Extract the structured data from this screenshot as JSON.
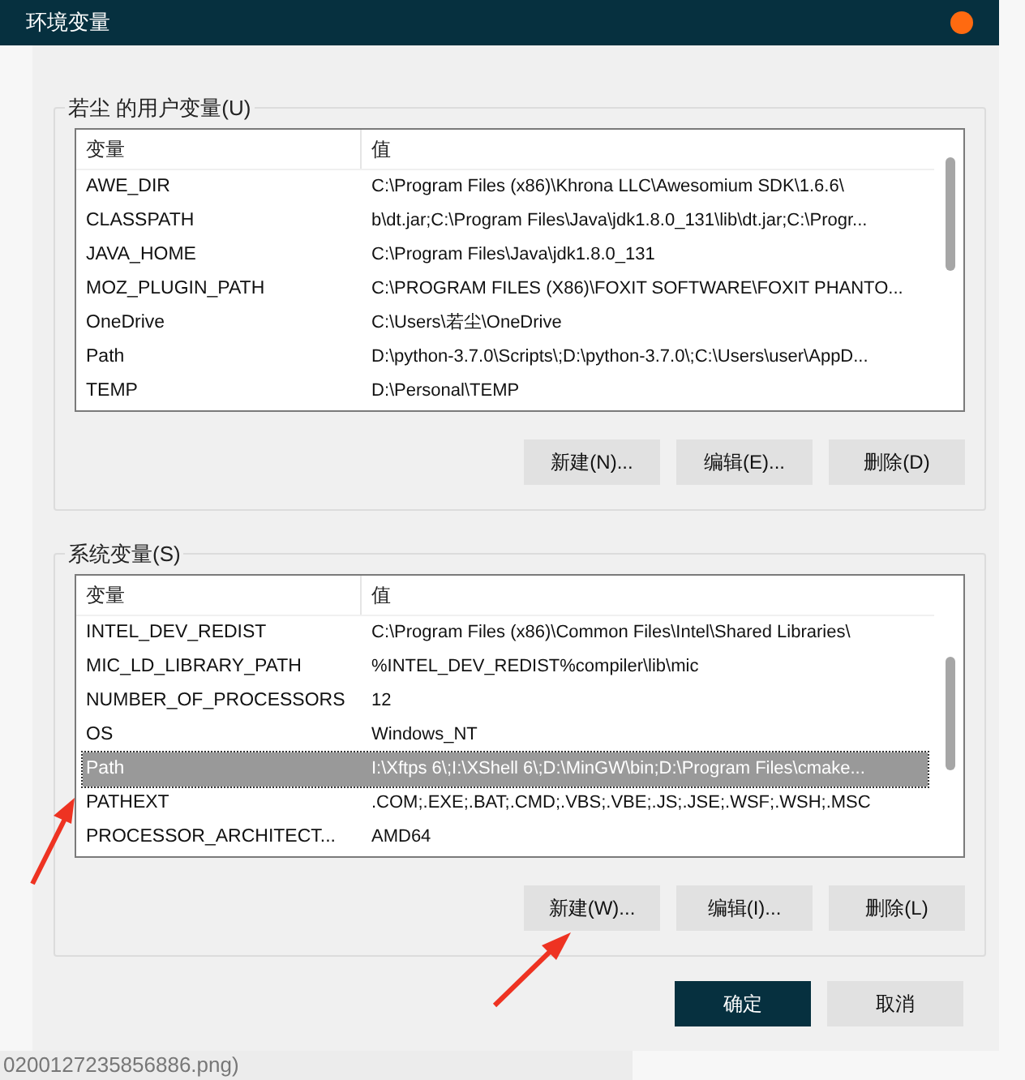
{
  "window": {
    "title": "环境变量"
  },
  "user_variables": {
    "label": "若尘 的用户变量(U)",
    "columns": [
      "变量",
      "值"
    ],
    "rows": [
      {
        "name": "AWE_DIR",
        "value": "C:\\Program Files (x86)\\Khrona LLC\\Awesomium SDK\\1.6.6\\",
        "selected": false
      },
      {
        "name": "CLASSPATH",
        "value": "b\\dt.jar;C:\\Program Files\\Java\\jdk1.8.0_131\\lib\\dt.jar;C:\\Progr...",
        "selected": false
      },
      {
        "name": "JAVA_HOME",
        "value": "C:\\Program Files\\Java\\jdk1.8.0_131",
        "selected": false
      },
      {
        "name": "MOZ_PLUGIN_PATH",
        "value": "C:\\PROGRAM FILES (X86)\\FOXIT SOFTWARE\\FOXIT PHANTO...",
        "selected": false
      },
      {
        "name": "OneDrive",
        "value": "C:\\Users\\若尘\\OneDrive",
        "selected": false
      },
      {
        "name": "Path",
        "value": "D:\\python-3.7.0\\Scripts\\;D:\\python-3.7.0\\;C:\\Users\\user\\AppD...",
        "selected": false
      },
      {
        "name": "TEMP",
        "value": "D:\\Personal\\TEMP",
        "selected": false
      }
    ],
    "buttons": [
      "新建(N)...",
      "编辑(E)...",
      "删除(D)"
    ]
  },
  "system_variables": {
    "label": "系统变量(S)",
    "columns": [
      "变量",
      "值"
    ],
    "rows": [
      {
        "name": "INTEL_DEV_REDIST",
        "value": "C:\\Program Files (x86)\\Common Files\\Intel\\Shared Libraries\\",
        "selected": false
      },
      {
        "name": "MIC_LD_LIBRARY_PATH",
        "value": "%INTEL_DEV_REDIST%compiler\\lib\\mic",
        "selected": false
      },
      {
        "name": "NUMBER_OF_PROCESSORS",
        "value": "12",
        "selected": false
      },
      {
        "name": "OS",
        "value": "Windows_NT",
        "selected": false
      },
      {
        "name": "Path",
        "value": "I:\\Xftps 6\\;I:\\XShell 6\\;D:\\MinGW\\bin;D:\\Program Files\\cmake...",
        "selected": true
      },
      {
        "name": "PATHEXT",
        "value": ".COM;.EXE;.BAT;.CMD;.VBS;.VBE;.JS;.JSE;.WSF;.WSH;.MSC",
        "selected": false
      },
      {
        "name": "PROCESSOR_ARCHITECT...",
        "value": "AMD64",
        "selected": false
      }
    ],
    "buttons": [
      "新建(W)...",
      "编辑(I)...",
      "删除(L)"
    ]
  },
  "dialog_buttons": [
    {
      "label": "确定",
      "primary": true
    },
    {
      "label": "取消",
      "primary": false
    }
  ],
  "background_text": "0200127235856886.png)"
}
